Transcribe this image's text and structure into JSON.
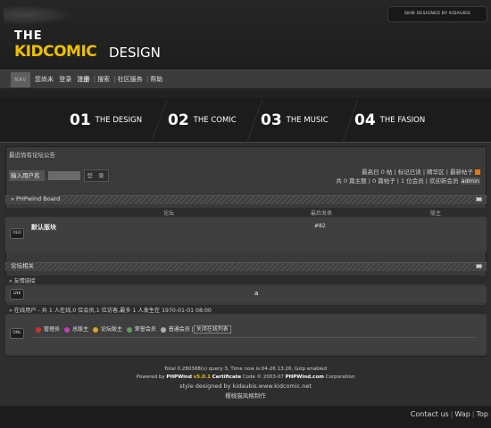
{
  "header": {
    "logo_the": "THE",
    "logo_kidcomic": "KIDCOMIC",
    "logo_design": "DESIGN",
    "skin_credit": "SKIN DESIGNED BY KIDAUBIS"
  },
  "nav": {
    "tag": "NAV",
    "greeting": "您尚未",
    "login": "登录",
    "register": "注册",
    "search": "搜索",
    "community": "社区服务",
    "help": "帮助"
  },
  "menu": [
    {
      "num": "01",
      "label": "THE DESIGN"
    },
    {
      "num": "02",
      "label": "THE COMIC"
    },
    {
      "num": "03",
      "label": "THE MUSIC"
    },
    {
      "num": "04",
      "label": "THE FASION"
    }
  ],
  "announce": "最近尚有论坛公告",
  "login_box": {
    "username_label": "输入用户名",
    "submit": "登 录"
  },
  "stats": {
    "today_posts": "最高日 0 帖",
    "mark_read": "标记已读",
    "digest": "精华区",
    "new_posts": "最新帖子",
    "totals": "共 0 篇主题 | 0 篇帖子 | 1 位会员 | 欢迎新会员",
    "newest_member": "admin"
  },
  "board": {
    "title": "» PHPwind Board",
    "col_forum": "论坛",
    "col_last": "最后发表",
    "col_mod": "版主",
    "forum_badge": "OLD",
    "forum_name": "默认版块",
    "forum_last": "#82"
  },
  "forum_related": {
    "title": "论坛相关",
    "links_title": "» 友情链接",
    "links_badge": "LNK",
    "links_value": "a"
  },
  "online": {
    "summary": "» 在线用户 - 共 1 人在线,0 位会员,1 位访客,最多 1 人发生在 1970-01-01 08:00",
    "badge": "ONL",
    "legend": [
      {
        "label": "管理员",
        "color": "#d0302a"
      },
      {
        "label": "总版主",
        "color": "#c040c0"
      },
      {
        "label": "论坛版主",
        "color": "#e0a020"
      },
      {
        "label": "荣誉会员",
        "color": "#5aa05a"
      },
      {
        "label": "普通会员",
        "color": "#b0b0b0"
      }
    ],
    "close_list": "关闭在线列表"
  },
  "footer": {
    "line1": "Total 0.280388(s) query 3, Time now is:04-26 13:26, Gzip enabled",
    "powered_prefix": "Powered by",
    "phpwind": "PHPWind",
    "version": "v5.0.1",
    "certificate": "Certificate",
    "code_text": "Code © 2003-07",
    "phpwind_com": "PHPWind.com",
    "corporation": "Corporation",
    "line3": "style designed by kidaubis.www.kidcomic.net",
    "line4": "樱桃猫风格制作"
  },
  "bottom_links": [
    "Contact us",
    "Wap",
    "Top"
  ]
}
